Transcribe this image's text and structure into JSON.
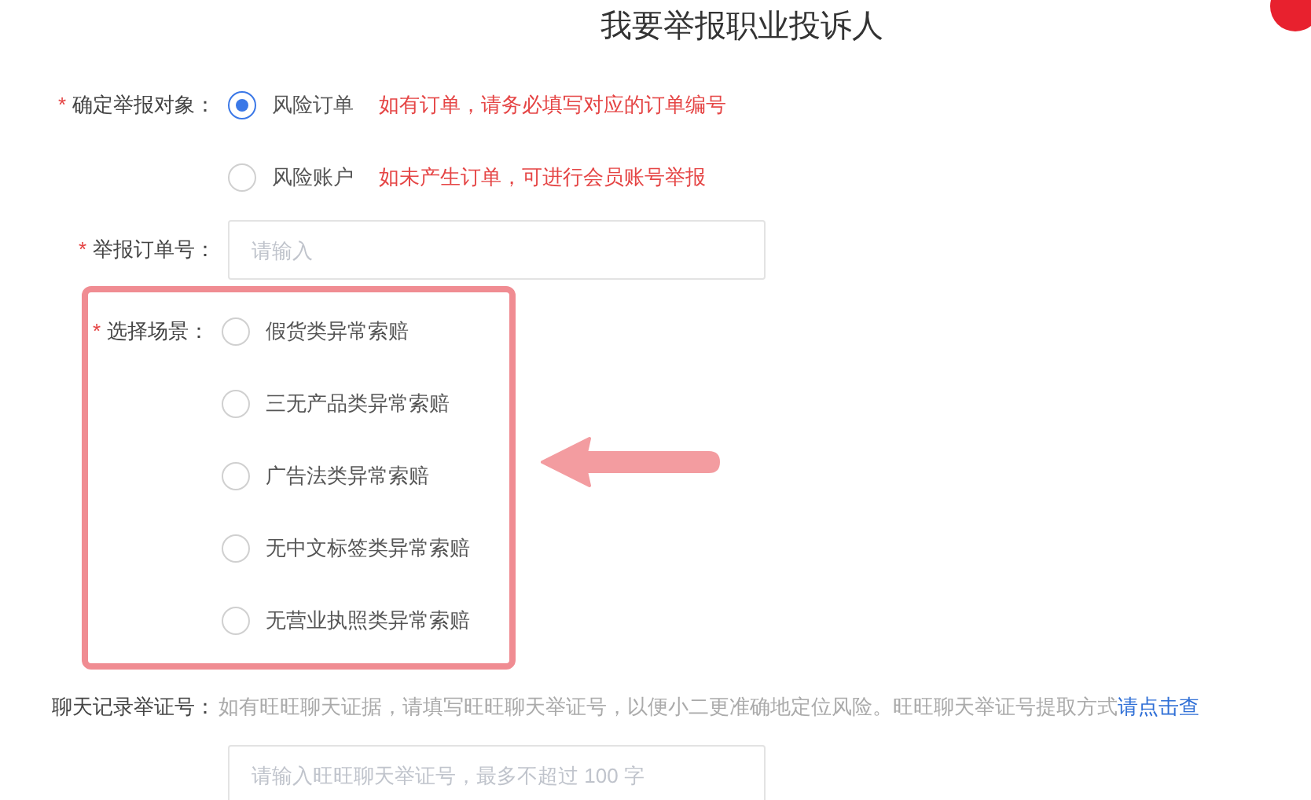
{
  "title": "我要举报职业投诉人",
  "report_target": {
    "label": "确定举报对象：",
    "required_mark": "*",
    "options": [
      {
        "label": "风险订单",
        "hint": "如有订单，请务必填写对应的订单编号",
        "selected": true
      },
      {
        "label": "风险账户",
        "hint": "如未产生订单，可进行会员账号举报",
        "selected": false
      }
    ]
  },
  "order_number": {
    "label": "举报订单号：",
    "required_mark": "*",
    "placeholder": "请输入"
  },
  "scenario": {
    "label": "选择场景：",
    "required_mark": "*",
    "highlighted": true,
    "options": [
      {
        "label": "假货类异常索赔",
        "selected": false
      },
      {
        "label": "三无产品类异常索赔",
        "selected": false
      },
      {
        "label": "广告法类异常索赔",
        "selected": false
      },
      {
        "label": "无中文标签类异常索赔",
        "selected": false
      },
      {
        "label": "无营业执照类异常索赔",
        "selected": false
      }
    ]
  },
  "chat_evidence": {
    "label": "聊天记录举证号：",
    "hint": "如有旺旺聊天证据，请填写旺旺聊天举证号，以便小二更准确地定位风险。旺旺聊天举证号提取方式",
    "link": "请点击查",
    "placeholder": "请输入旺旺聊天举证号，最多不超过 100 字"
  }
}
